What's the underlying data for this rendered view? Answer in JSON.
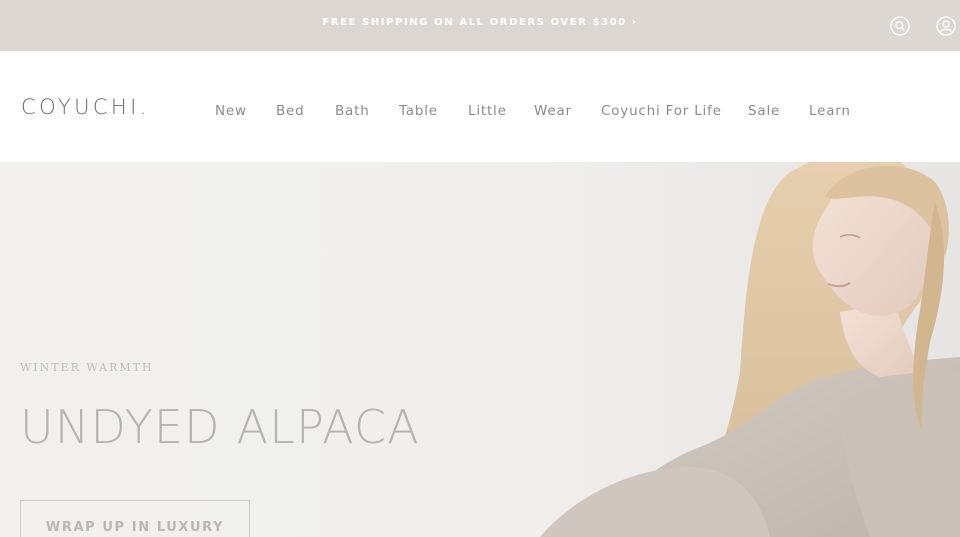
{
  "announcement": {
    "text": "FREE SHIPPING ON ALL ORDERS OVER $300 ›",
    "search_icon": "search-icon",
    "account_icon": "user-icon"
  },
  "header": {
    "logo": "COYUCHI",
    "logo_dot": ".",
    "nav": [
      {
        "label": "New"
      },
      {
        "label": "Bed"
      },
      {
        "label": "Bath"
      },
      {
        "label": "Table"
      },
      {
        "label": "Little"
      },
      {
        "label": "Wear"
      },
      {
        "label": "Coyuchi For Life"
      },
      {
        "label": "Sale"
      },
      {
        "label": "Learn"
      }
    ]
  },
  "hero": {
    "kicker": "WINTER WARMTH",
    "title": "UNDYED ALPACA",
    "cta": "WRAP UP IN LUXURY"
  },
  "colors": {
    "topbar_bg": "#ddd7d3",
    "hero_bg": "#f0efee",
    "nav_text": "#8f8b89",
    "logo": "#6d6a69"
  }
}
